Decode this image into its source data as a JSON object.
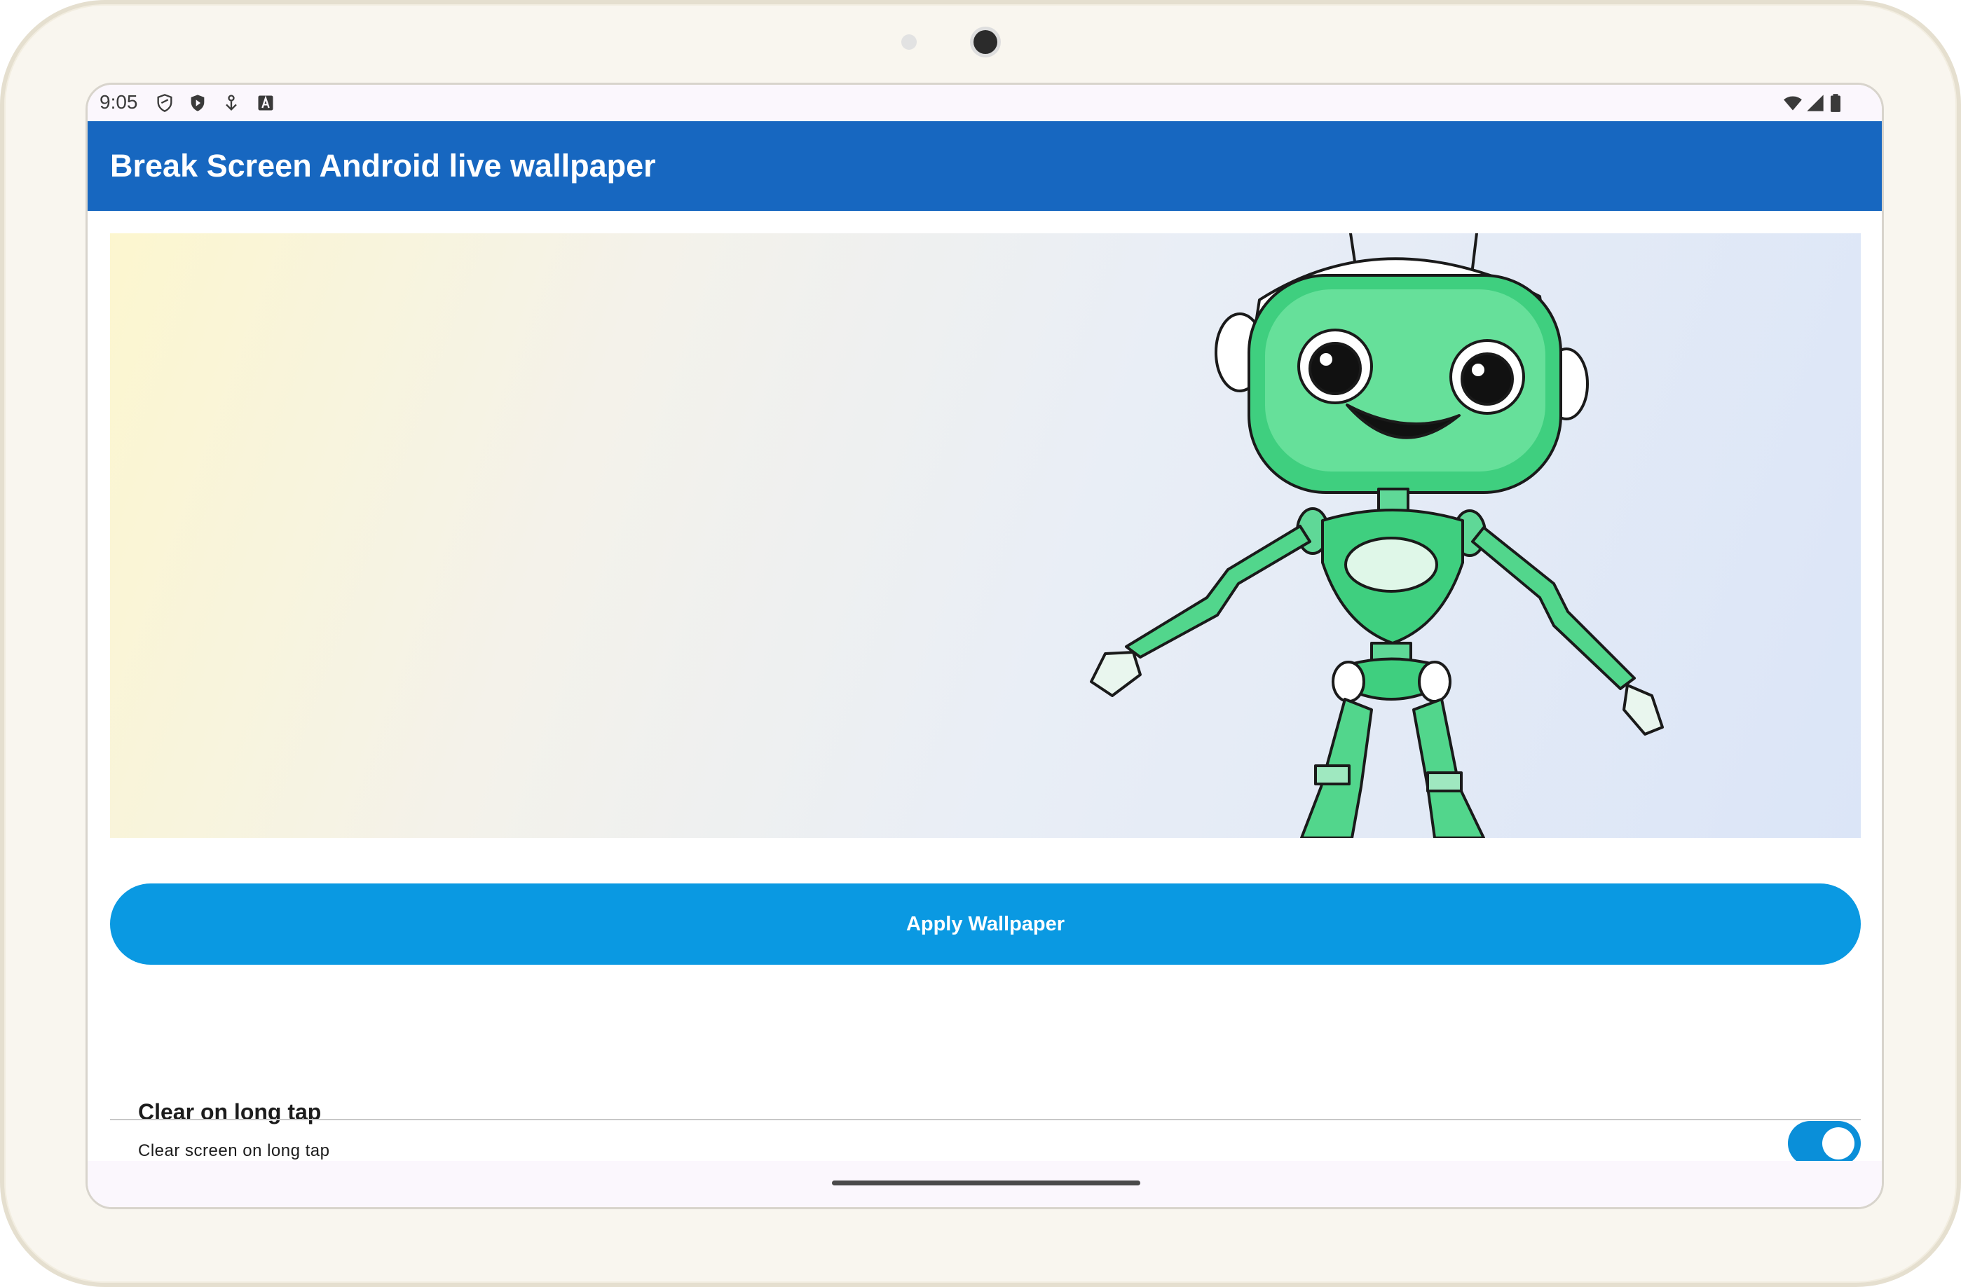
{
  "status_bar": {
    "time": "9:05",
    "left_icons": [
      "shield-outline-icon",
      "play-shield-icon",
      "download-person-icon",
      "font-a-icon"
    ],
    "right_icons": [
      "wifi-icon",
      "cellular-signal-icon",
      "battery-icon"
    ]
  },
  "app_bar": {
    "title": "Break Screen Android live wallpaper",
    "color": "#1767c0"
  },
  "preview": {
    "illustration": "green-robot-illustration"
  },
  "apply_button": {
    "label": "Apply Wallpaper",
    "color": "#0a99e2"
  },
  "preference": {
    "title": "Clear on long tap",
    "summary": "Clear screen on long tap",
    "enabled": true,
    "toggle_color": "#0a8fd9"
  }
}
